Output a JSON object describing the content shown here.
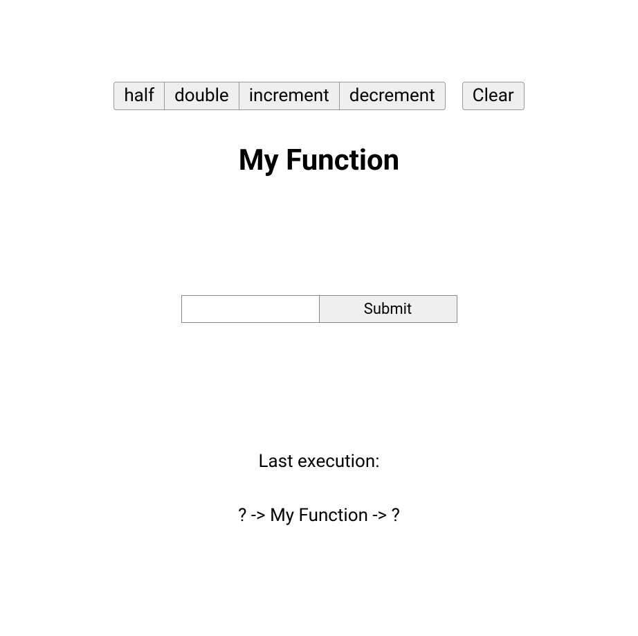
{
  "toolbar": {
    "ops": [
      {
        "label": "half"
      },
      {
        "label": "double"
      },
      {
        "label": "increment"
      },
      {
        "label": "decrement"
      }
    ],
    "clear_label": "Clear"
  },
  "title": "My Function",
  "form": {
    "input_value": "",
    "submit_label": "Submit"
  },
  "last_execution": {
    "label": "Last execution:",
    "value": "? -> My Function -> ?"
  }
}
